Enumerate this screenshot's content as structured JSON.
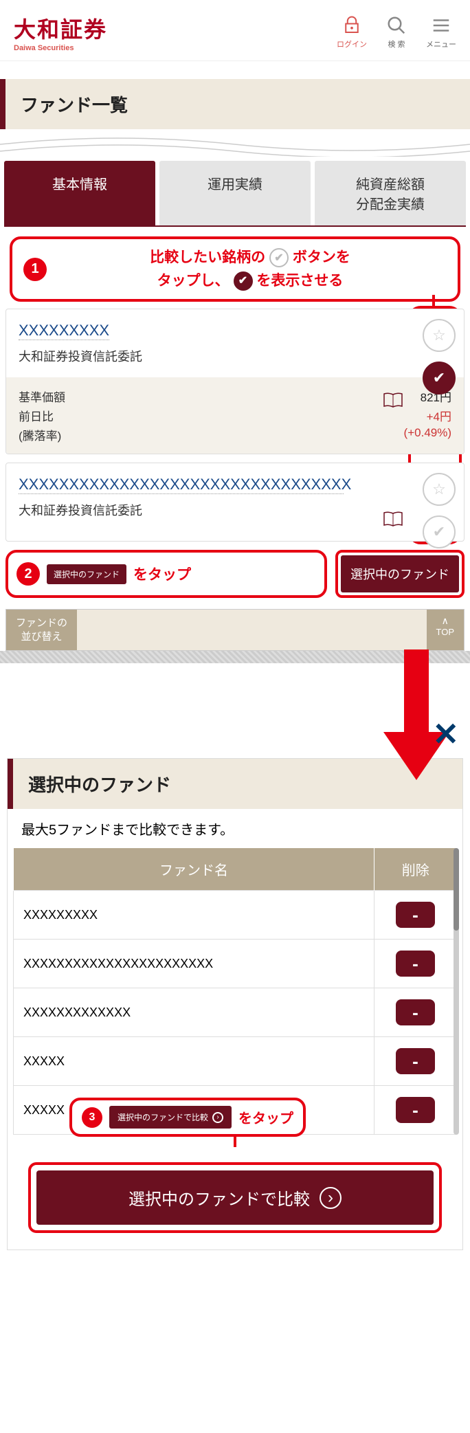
{
  "header": {
    "logo_main": "大和証券",
    "logo_sub": "Daiwa Securities",
    "login": "ログイン",
    "search": "検 索",
    "menu": "メニュー"
  },
  "page_title": "ファンド一覧",
  "tabs": {
    "basic": "基本情報",
    "perf": "運用実績",
    "asset": "純資産総額\n分配金実績"
  },
  "callout1": {
    "text_a": "比較したい銘柄の",
    "text_b": "ボタンを",
    "text_c": "タップし、",
    "text_d": "を表示させる"
  },
  "fund1": {
    "name": "XXXXXXXXX",
    "company": "大和証券投資信託委託",
    "base_label": "基準価額",
    "base_val": "821円",
    "prev_label": "前日比",
    "prev_val": "+4円",
    "rate_label": "(騰落率)",
    "rate_val": "(+0.49%)"
  },
  "fund2": {
    "name": "XXXXXXXXXXXXXXXXXXXXXXXXXXXXXXXXX",
    "company": "大和証券投資信託委託"
  },
  "callout2": {
    "btn_text": "選択中のファンド",
    "suffix": "をタップ"
  },
  "selected_button": "選択中のファンド",
  "sort": {
    "label": "ファンドの\n並び替え",
    "top": "TOP"
  },
  "modal": {
    "title": "選択中のファンド",
    "note": "最大5ファンドまで比較できます。",
    "th_name": "ファンド名",
    "th_del": "削除",
    "rows": [
      "XXXXXXXXX",
      "XXXXXXXXXXXXXXXXXXXXXXX",
      "XXXXXXXXXXXXX",
      "XXXXX",
      "XXXXX"
    ],
    "del_label": "-"
  },
  "callout3": {
    "btn_text": "選択中のファンドで比較",
    "suffix": "をタップ"
  },
  "compare_button": "選択中のファンドで比較"
}
